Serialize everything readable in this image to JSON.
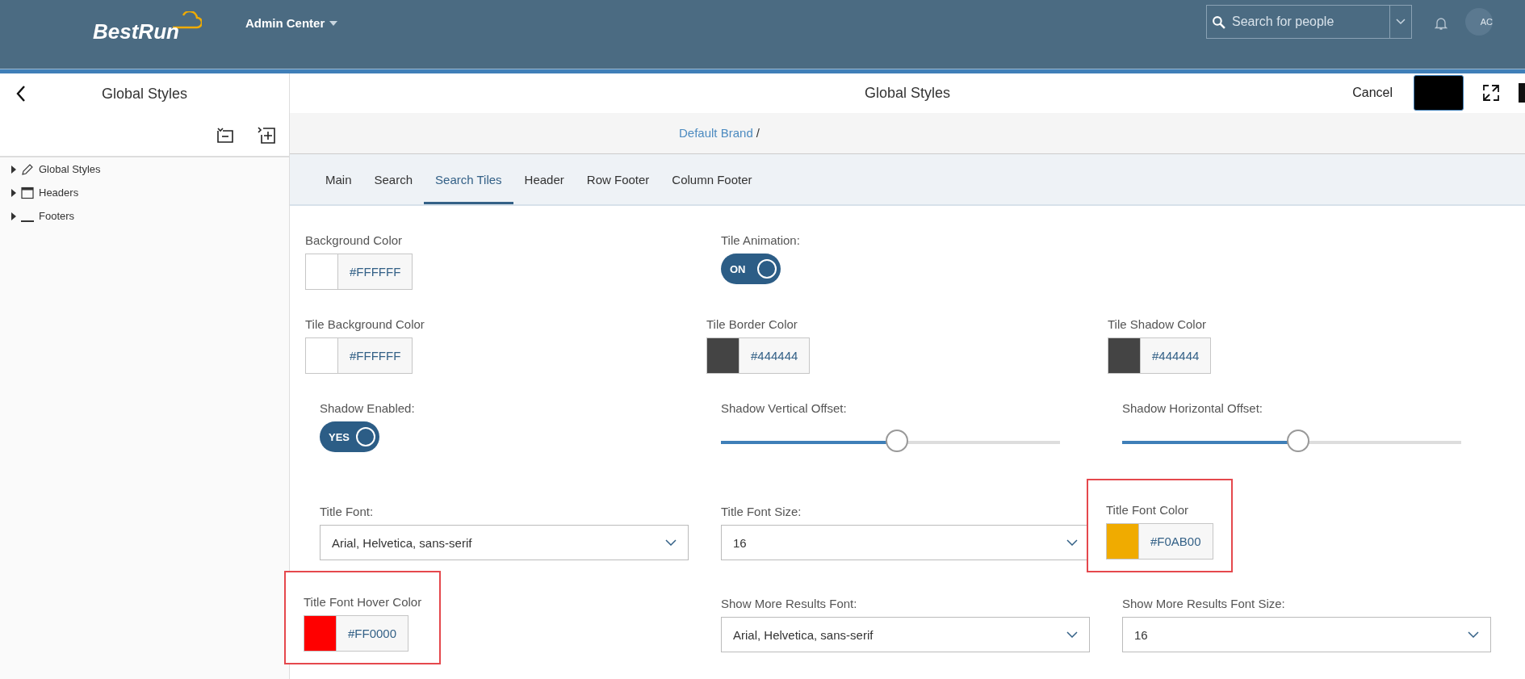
{
  "header": {
    "logo": "BestRun",
    "menu": "Admin Center",
    "search": {
      "placeholder": "Search for people"
    },
    "avatar": "AC"
  },
  "sidebar": {
    "title": "Global Styles",
    "items": [
      {
        "label": "Global Styles",
        "kind": "pencil",
        "expanded": false
      },
      {
        "label": "Headers",
        "kind": "window",
        "expanded": false
      },
      {
        "label": "Footers",
        "kind": "underline",
        "expanded": false
      }
    ]
  },
  "toolbar": {
    "title": "Global Styles",
    "cancel": "Cancel"
  },
  "breadcrumb": {
    "link": "Default Brand",
    "separator": "/"
  },
  "tabs": [
    {
      "label": "Main",
      "selected": false
    },
    {
      "label": "Search",
      "selected": false
    },
    {
      "label": "Search Tiles",
      "selected": true
    },
    {
      "label": "Header",
      "selected": false
    },
    {
      "label": "Row Footer",
      "selected": false
    },
    {
      "label": "Column Footer",
      "selected": false
    }
  ],
  "rows": [
    [
      {
        "kind": "color",
        "label": "Background Color",
        "value": "#FFFFFF",
        "color": "#ffffff",
        "highlighted": false
      },
      {
        "kind": "toggle",
        "label": "Tile Animation:",
        "text": "ON",
        "on": true
      }
    ],
    [
      {
        "kind": "color",
        "label": "Tile Background Color",
        "value": "#FFFFFF",
        "color": "#ffffff",
        "highlighted": false
      },
      {
        "kind": "color",
        "label": "Tile Border Color",
        "value": "#444444",
        "color": "#444444",
        "highlighted": false
      },
      {
        "kind": "color",
        "label": "Tile Shadow Color",
        "value": "#444444",
        "color": "#444444",
        "highlighted": false
      }
    ],
    [
      {
        "kind": "toggle",
        "label": "Shadow Enabled:",
        "text": "YES",
        "on": true
      },
      {
        "kind": "slider",
        "label": "Shadow Vertical Offset:",
        "level": 0.52
      },
      {
        "kind": "slider",
        "label": "Shadow Horizontal Offset:",
        "level": 0.52
      }
    ],
    [
      {
        "kind": "select",
        "label": "Title Font:",
        "value": "Arial, Helvetica, sans-serif"
      },
      {
        "kind": "select",
        "label": "Title Font Size:",
        "value": "16"
      },
      {
        "kind": "color",
        "label": "Title Font Color",
        "value": "#F0AB00",
        "color": "#f0ab00",
        "highlighted": true
      }
    ],
    [
      {
        "kind": "color",
        "label": "Title Font Hover Color",
        "value": "#FF0000",
        "color": "#ff0000",
        "highlighted": true
      },
      {
        "kind": "select",
        "label": "Show More Results Font:",
        "value": "Arial, Helvetica, sans-serif"
      },
      {
        "kind": "select",
        "label": "Show More Results Font Size:",
        "value": "16"
      }
    ]
  ]
}
